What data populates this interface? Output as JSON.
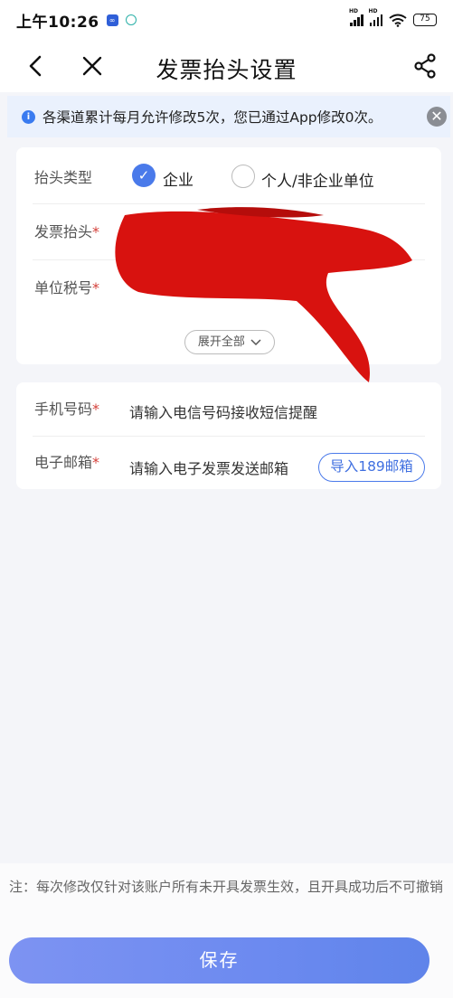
{
  "status_bar": {
    "time": "上午10:26",
    "app_icon_text": "∞",
    "signal_1_label": "HD",
    "signal_2_label": "HD",
    "battery": "75"
  },
  "nav": {
    "title": "发票抬头设置",
    "icons": [
      "back-icon",
      "close-icon",
      "share-icon"
    ]
  },
  "notice": {
    "text": "各渠道累计每月允许修改5次，您已通过App修改0次。",
    "info_glyph": "i",
    "close_glyph": "✕"
  },
  "form": {
    "header_type_label": "抬头类型",
    "options": [
      {
        "label": "企业",
        "selected": true
      },
      {
        "label": "个人/非企业单位",
        "selected": false
      }
    ],
    "invoice_title_label": "发票抬头",
    "tax_id_label": "单位税号",
    "required_mark": "*",
    "expand_label": "展开全部",
    "phone_label": "手机号码",
    "phone_placeholder": "请输入电信号码接收短信提醒",
    "email_label": "电子邮箱",
    "email_placeholder": "请输入电子发票发送邮箱",
    "import_button": "导入189邮箱"
  },
  "footer": {
    "note": "注：每次修改仅针对该账户所有未开具发票生效，且开具成功后不可撤销",
    "save_button": "保存"
  },
  "colors": {
    "accent": "#4a7aea",
    "required": "#d4413a",
    "redaction": "#d8120f",
    "notice_bg": "#eaf1fd"
  }
}
